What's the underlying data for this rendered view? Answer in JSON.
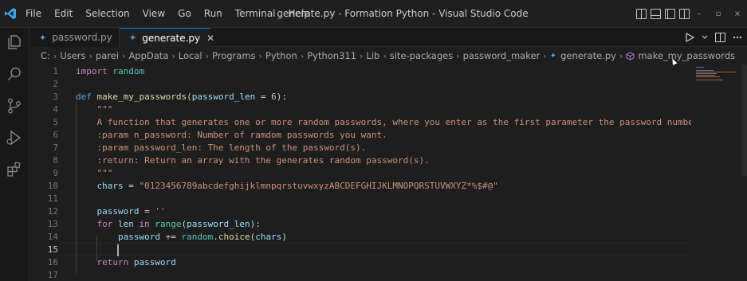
{
  "titlebar": {
    "menu": [
      "File",
      "Edit",
      "Selection",
      "View",
      "Go",
      "Run",
      "Terminal",
      "Help"
    ],
    "window_title": "generate.py - Formation Python - Visual Studio Code",
    "window_controls": [
      "–",
      "▫",
      "×"
    ]
  },
  "activity_icons": [
    "explorer-icon",
    "search-icon",
    "source-control-icon",
    "run-debug-icon",
    "extensions-icon"
  ],
  "tabs": [
    {
      "label": "password.py",
      "active": false
    },
    {
      "label": "generate.py",
      "active": true,
      "close": "✕"
    }
  ],
  "breadcrumb": [
    "C:",
    "Users",
    "parei",
    "AppData",
    "Local",
    "Programs",
    "Python",
    "Python311",
    "Lib",
    "site-packages",
    "password_maker",
    "generate.py",
    "make_my_passwords"
  ],
  "editor": {
    "current_line": 15,
    "lines": [
      {
        "n": "1",
        "tokens": [
          {
            "t": "import ",
            "c": "kw2"
          },
          {
            "t": "random",
            "c": "ns"
          }
        ]
      },
      {
        "n": "2",
        "tokens": []
      },
      {
        "n": "3",
        "tokens": [
          {
            "t": "def ",
            "c": "kw"
          },
          {
            "t": "make_my_passwords",
            "c": "fn"
          },
          {
            "t": "(",
            "c": "plain"
          },
          {
            "t": "password_len",
            "c": "param"
          },
          {
            "t": " = ",
            "c": "plain"
          },
          {
            "t": "6",
            "c": "num"
          },
          {
            "t": "):",
            "c": "plain"
          }
        ]
      },
      {
        "n": "4",
        "tokens": [
          {
            "t": "    \"\"\"",
            "c": "str"
          }
        ]
      },
      {
        "n": "5",
        "tokens": [
          {
            "t": "    A function that generates one or more random passwords, where you enter as the first parameter the password number",
            "c": "str"
          }
        ]
      },
      {
        "n": "6",
        "tokens": [
          {
            "t": "    :param n_password: Number of ramdom passwords you want.",
            "c": "str"
          }
        ]
      },
      {
        "n": "7",
        "tokens": [
          {
            "t": "    :param password_len: The length of the password(s).",
            "c": "str"
          }
        ]
      },
      {
        "n": "8",
        "tokens": [
          {
            "t": "    :return: Return an array with the generates random password(s).",
            "c": "str"
          }
        ]
      },
      {
        "n": "9",
        "tokens": [
          {
            "t": "    \"\"\"",
            "c": "str"
          }
        ]
      },
      {
        "n": "10",
        "tokens": [
          {
            "t": "    chars",
            "c": "param"
          },
          {
            "t": " = ",
            "c": "plain"
          },
          {
            "t": "\"0123456789abcdefghijklmnpqrstuvwxyzABCDEFGHIJKLMNOPQRSTUVWXYZ*%$#@\"",
            "c": "str"
          }
        ]
      },
      {
        "n": "11",
        "tokens": []
      },
      {
        "n": "12",
        "tokens": [
          {
            "t": "    password",
            "c": "param"
          },
          {
            "t": " = ",
            "c": "plain"
          },
          {
            "t": "''",
            "c": "str"
          }
        ]
      },
      {
        "n": "13",
        "tokens": [
          {
            "t": "    for ",
            "c": "kw2"
          },
          {
            "t": "len",
            "c": "param"
          },
          {
            "t": " in ",
            "c": "kw2"
          },
          {
            "t": "range",
            "c": "ns"
          },
          {
            "t": "(",
            "c": "plain"
          },
          {
            "t": "password_len",
            "c": "param"
          },
          {
            "t": "):",
            "c": "plain"
          }
        ]
      },
      {
        "n": "14",
        "tokens": [
          {
            "t": "        password",
            "c": "param"
          },
          {
            "t": " += ",
            "c": "plain"
          },
          {
            "t": "random",
            "c": "ns"
          },
          {
            "t": ".",
            "c": "plain"
          },
          {
            "t": "choice",
            "c": "fn"
          },
          {
            "t": "(",
            "c": "plain"
          },
          {
            "t": "chars",
            "c": "param"
          },
          {
            "t": ")",
            "c": "plain"
          }
        ]
      },
      {
        "n": "15",
        "tokens": []
      },
      {
        "n": "16",
        "tokens": [
          {
            "t": "    return ",
            "c": "kw2"
          },
          {
            "t": "password",
            "c": "param"
          }
        ]
      },
      {
        "n": "17",
        "tokens": []
      }
    ]
  },
  "colors": {
    "accent": "#0078d4",
    "python_icon": "#4aa3df",
    "string": "#ce9178",
    "keyword": "#569cd6"
  }
}
